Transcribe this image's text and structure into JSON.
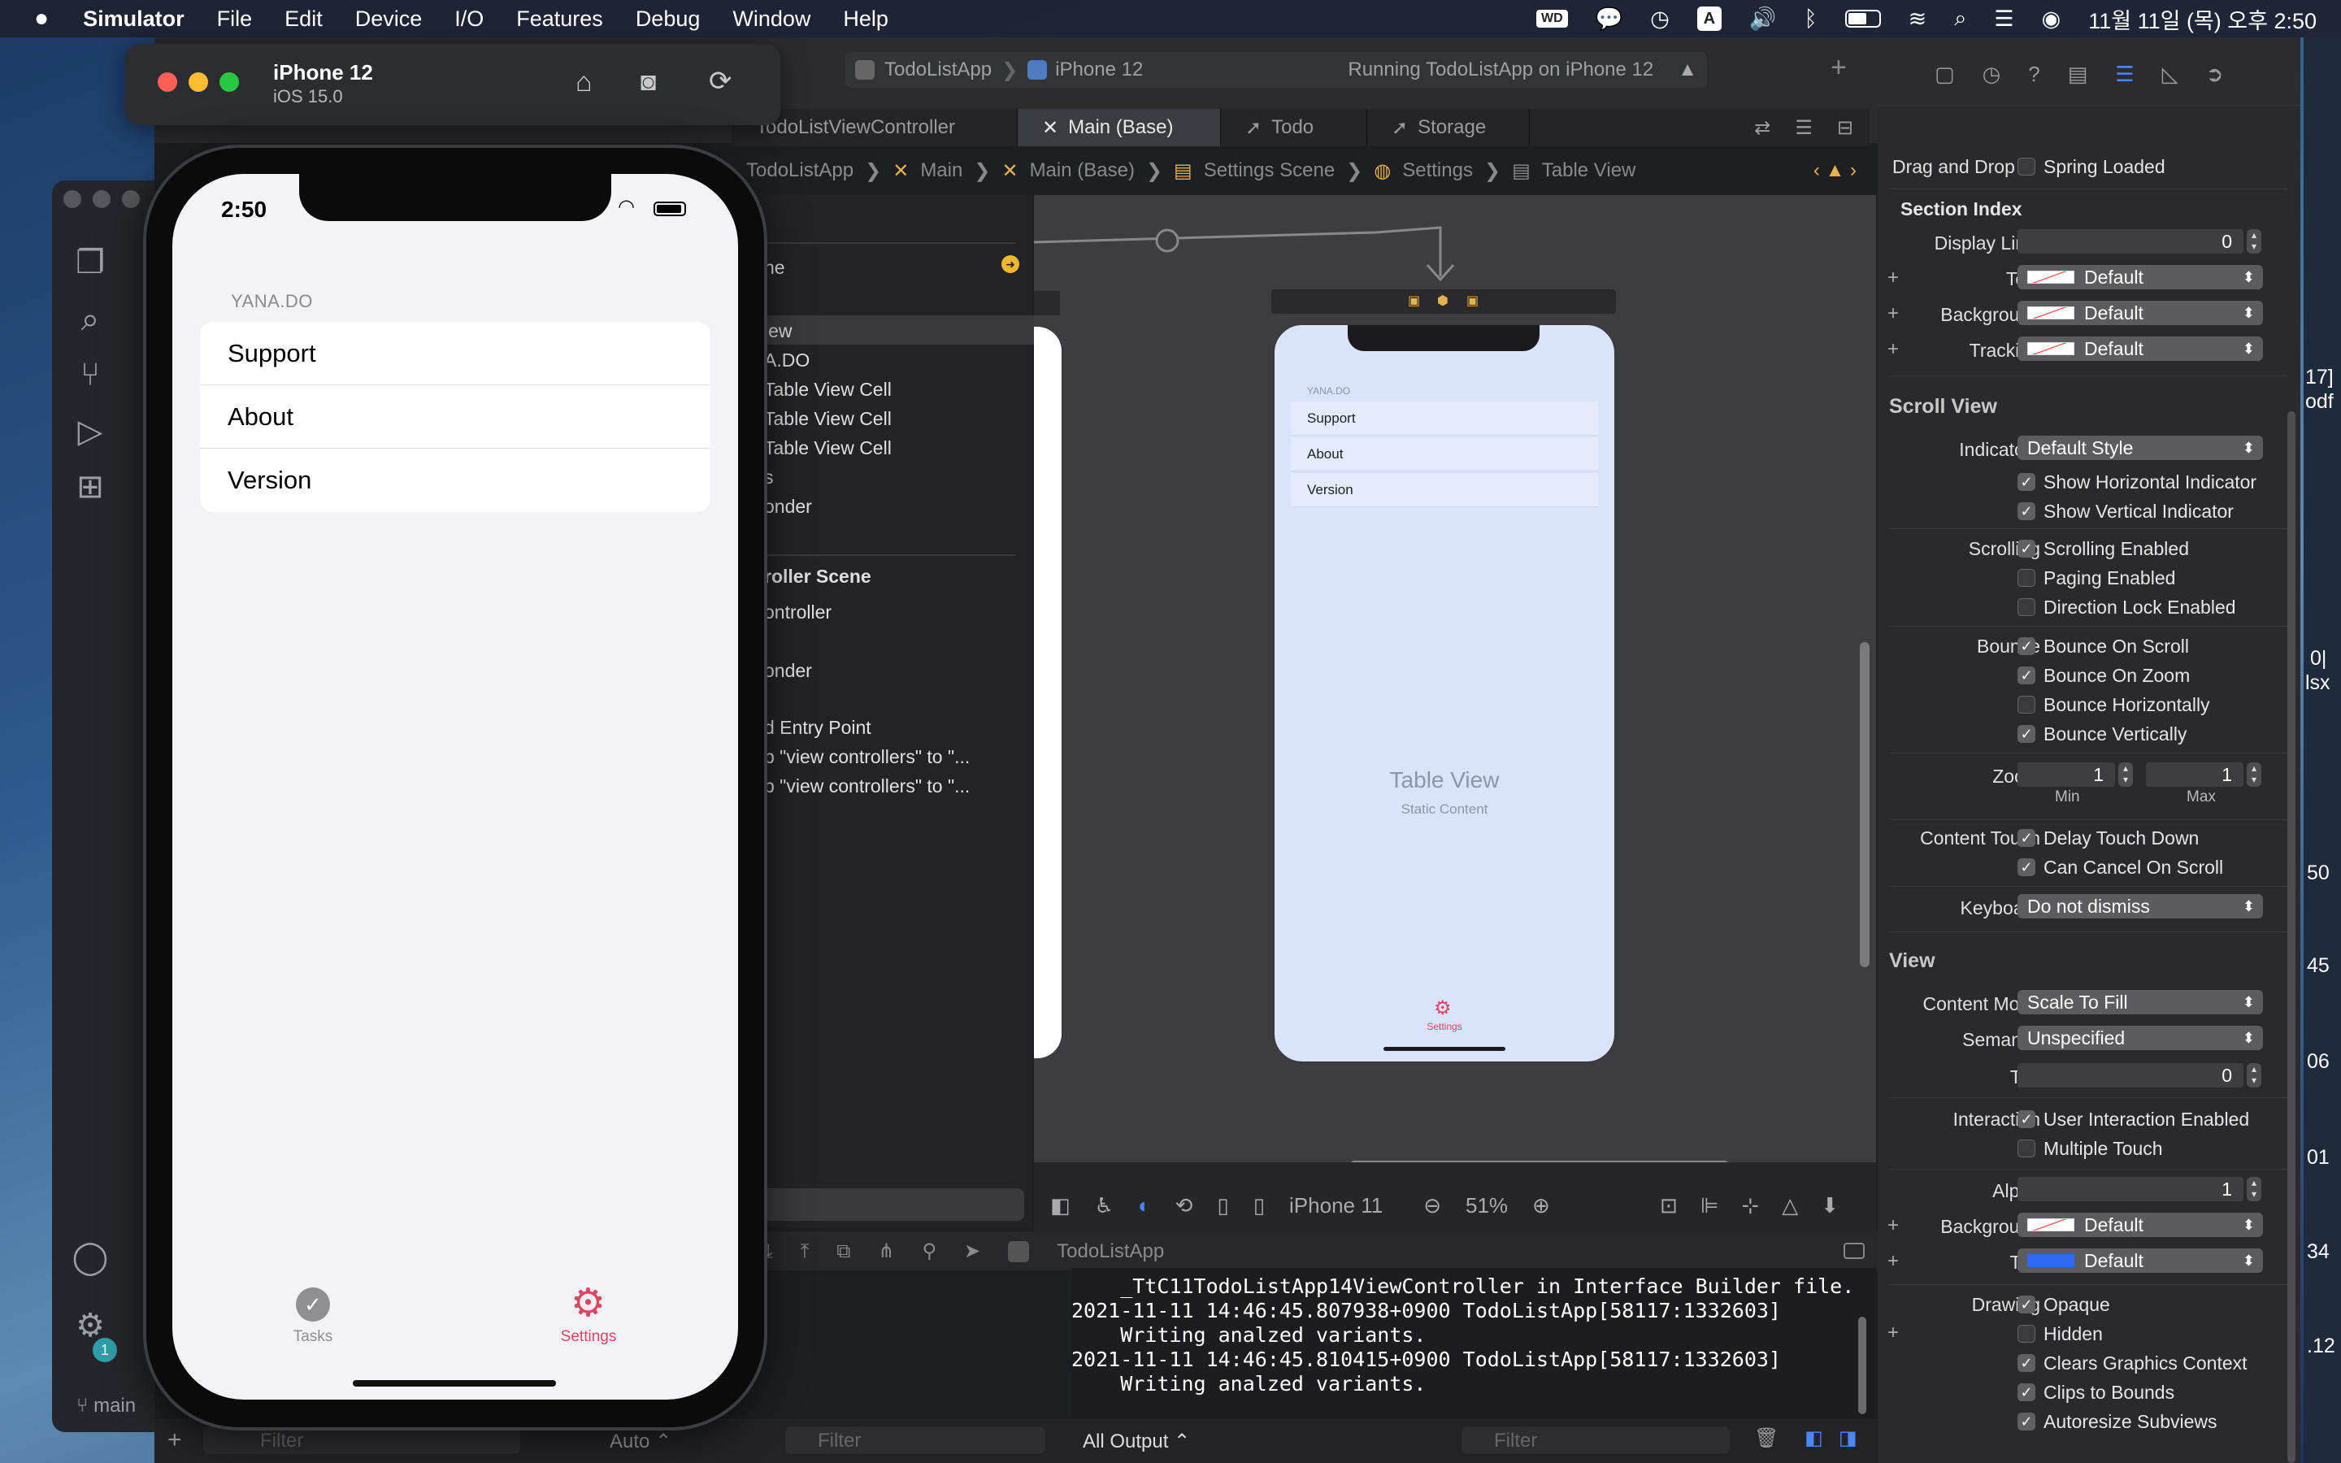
{
  "menubar": {
    "apple": "",
    "app": "Simulator",
    "items": [
      "File",
      "Edit",
      "Device",
      "I/O",
      "Features",
      "Debug",
      "Window",
      "Help"
    ],
    "wd_badge": "WD",
    "input_source": "A",
    "datetime": "11월 11일 (목) 오후 2:50"
  },
  "simulator": {
    "device": "iPhone 12",
    "os": "iOS 15.0",
    "status_time": "2:50",
    "section_header": "YANA.DO",
    "cells": [
      "Support",
      "About",
      "Version"
    ],
    "tabs": [
      {
        "label": "Tasks",
        "color": "#8e8e93"
      },
      {
        "label": "Settings",
        "color": "#e2455f"
      }
    ]
  },
  "xcode": {
    "scheme_project": "TodoListApp",
    "scheme_device": "iPhone 12",
    "run_status": "Running TodoListApp on iPhone 12",
    "tabs": [
      "TodoListViewController",
      "Main (Base)",
      "Todo",
      "Storage"
    ],
    "breadcrumb": [
      "TodoListApp",
      "Main",
      "Main (Base)",
      "Settings Scene",
      "Settings",
      "Table View"
    ],
    "outline": [
      "ne",
      "iew",
      "A.DO",
      "Table View Cell",
      "Table View Cell",
      "Table View Cell",
      "s",
      "onder",
      "roller Scene",
      "ontroller",
      "onder",
      "d Entry Point",
      "p \"view controllers\" to \"...",
      "p \"view controllers\" to \"..."
    ],
    "canvas": {
      "mini_header": "YANA.DO",
      "mini_cells": [
        "Support",
        "About",
        "Version"
      ],
      "placeholder_title": "Table View",
      "placeholder_sub": "Static Content",
      "mini_tab": "Settings",
      "device_label": "iPhone 11",
      "zoom": "51%"
    },
    "debug_target": "TodoListApp",
    "console_lines": [
      "    _TtC11TodoListApp14ViewController in Interface Builder file.",
      "2021-11-11 14:46:45.807938+0900 TodoListApp[58117:1332603]",
      "    Writing analzed variants.",
      "2021-11-11 14:46:45.810415+0900 TodoListApp[58117:1332603]",
      "    Writing analzed variants."
    ],
    "output_selector": "All Output",
    "auto_label": "Auto",
    "filter_placeholder": "Filter",
    "vscode_branch": "main",
    "vscode_badge": "1",
    "edge_text": [
      "17]",
      "odf",
      "0|",
      "lsx",
      "50",
      "45",
      "06",
      "01",
      "34",
      ".12"
    ]
  },
  "inspector": {
    "drag_drop": {
      "label": "Drag and Drop",
      "option": "Spring Loaded",
      "checked": false
    },
    "section_index": "Section Index",
    "display_limit": {
      "label": "Display Limit",
      "value": "0"
    },
    "text": {
      "label": "Text",
      "value": "Default"
    },
    "background": {
      "label": "Background",
      "value": "Default"
    },
    "tracking": {
      "label": "Tracking",
      "value": "Default"
    },
    "scroll_view": "Scroll View",
    "indicators": {
      "label": "Indicators",
      "value": "Default Style"
    },
    "show_h": "Show Horizontal Indicator",
    "show_v": "Show Vertical Indicator",
    "scrolling": "Scrolling",
    "scrolling_enabled": "Scrolling Enabled",
    "paging_enabled": "Paging Enabled",
    "direction_lock": "Direction Lock Enabled",
    "bounce": "Bounce",
    "bounce_scroll": "Bounce On Scroll",
    "bounce_zoom": "Bounce On Zoom",
    "bounce_h": "Bounce Horizontally",
    "bounce_v": "Bounce Vertically",
    "zoom": {
      "label": "Zoom",
      "min": "1",
      "max": "1",
      "min_label": "Min",
      "max_label": "Max"
    },
    "content_touch": "Content Touch",
    "delay_touch": "Delay Touch Down",
    "cancel_scroll": "Can Cancel On Scroll",
    "keyboard": {
      "label": "Keyboard",
      "value": "Do not dismiss"
    },
    "view": "View",
    "content_mode": {
      "label": "Content Mode",
      "value": "Scale To Fill"
    },
    "semantic": {
      "label": "Semantic",
      "value": "Unspecified"
    },
    "tag": {
      "label": "Tag",
      "value": "0"
    },
    "interaction": "Interaction",
    "user_interaction": "User Interaction Enabled",
    "multiple_touch": "Multiple Touch",
    "alpha": {
      "label": "Alpha",
      "value": "1"
    },
    "view_background": {
      "label": "Background",
      "value": "Default"
    },
    "tint": {
      "label": "Tint",
      "value": "Default"
    },
    "drawing": "Drawing",
    "opaque": "Opaque",
    "hidden": "Hidden",
    "clears": "Clears Graphics Context",
    "clips": "Clips to Bounds",
    "autoresize": "Autoresize Subviews"
  }
}
